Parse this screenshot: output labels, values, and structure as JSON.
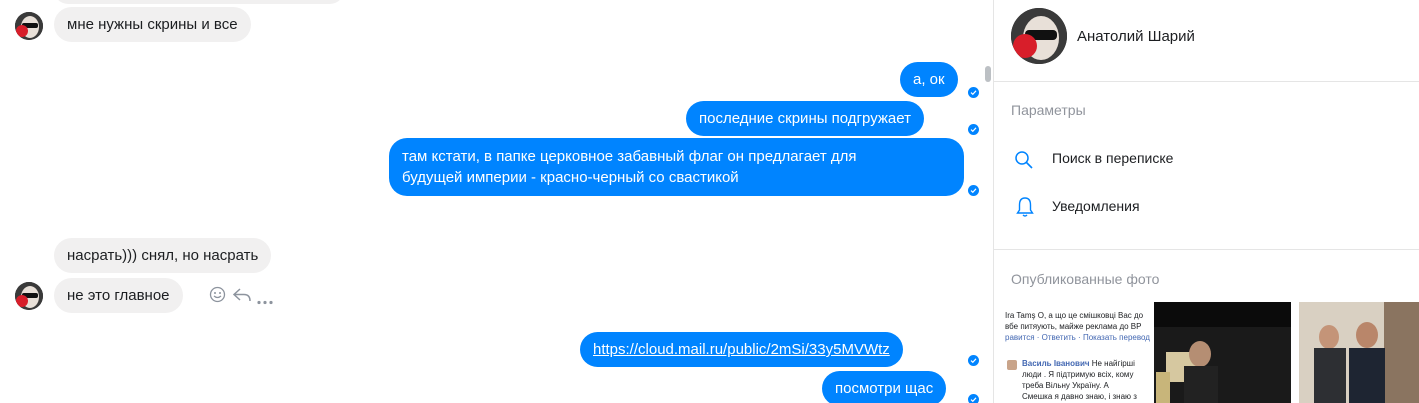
{
  "messages": {
    "m1": "мне нужны скрины и все",
    "m2": "а, ок",
    "m3": "последние скрины подгружает",
    "m4_line1": "там кстати, в папке церковное забавный флаг он предлагает для",
    "m4_line2": "будущей империи - красно-черный со свастикой",
    "m5": "насрать))) снял, но насрать",
    "m6": "не это главное",
    "m7": "https://cloud.mail.ru/public/2mSi/33y5MVWtz",
    "m8": "посмотри щас"
  },
  "sidebar": {
    "contact_name": "Анатолий Шарий",
    "params_label": "Параметры",
    "search_label": "Поиск в переписке",
    "notifications_label": "Уведомления",
    "photos_label": "Опубликованные фото"
  },
  "photo1": {
    "author_line": "Ira Tamş  О, а що це смішковці Вас до",
    "author_line2": "вбе питяують, майже реклама до ВР",
    "actions": "равится · Ответить · Показать перевод",
    "comment_name": "Василь Іванович",
    "comment_text1": "Не найгірші",
    "comment_text2": "люди . Я підтримую всіх, кому",
    "comment_text3": "треба Вільну Україну. А",
    "comment_text4": "Смешка я давно знаю, і знаю з"
  },
  "colors": {
    "outgoing_bubble": "#0084ff",
    "incoming_bubble": "#f1f0f0",
    "seen_check": "#0084ff"
  },
  "icons": [
    "avatar",
    "check-icon",
    "emoji-icon",
    "reply-icon",
    "more-icon",
    "search-icon",
    "bell-icon"
  ]
}
